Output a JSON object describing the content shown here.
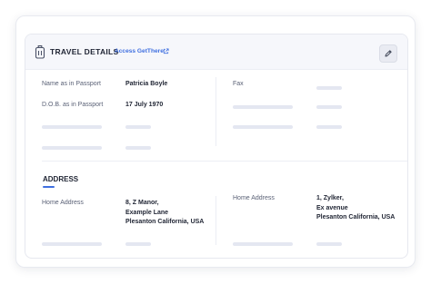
{
  "header": {
    "title": "TRAVEL DETAILS",
    "access_link": "Access GetThere"
  },
  "travel": {
    "passport_name_label": "Name as in Passport",
    "passport_name_value": "Patricia Boyle",
    "dob_label": "D.O.B. as in Passport",
    "dob_value": "17 July 1970",
    "fax_label": "Fax"
  },
  "address": {
    "section_title": "ADDRESS",
    "left_label": "Home Address",
    "left_lines": [
      "8, Z Manor,",
      "Example Lane",
      "Plesanton California, USA"
    ],
    "right_label": "Home Address",
    "right_lines": [
      "1, Zylker,",
      "Ex avenue",
      "Plesanton California, USA"
    ]
  },
  "colors": {
    "accent": "#3f6fe0",
    "text_dark": "#1f2433",
    "text_muted": "#5a6176",
    "skeleton": "#e4e7f1",
    "header_bg": "#f6f7fb"
  }
}
